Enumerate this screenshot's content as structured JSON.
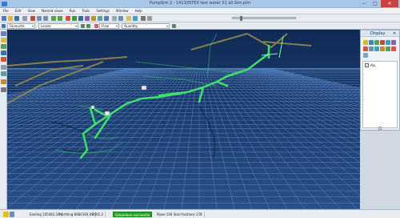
{
  "window": {
    "title": "PumpSim 2 - 14110STEX test water 01 all.Sim.pim",
    "min": "−",
    "max": "□",
    "close": "✕"
  },
  "menu": [
    "File",
    "Edit",
    "View",
    "Named views",
    "Run",
    "Tools",
    "Settings",
    "Window",
    "Help"
  ],
  "toolbar": {
    "combo1": "Favourite",
    "combo2": "Levels",
    "combo3": "Flow",
    "combo4": "Quantity"
  },
  "display_panel": {
    "title": "Display",
    "close": "✕",
    "item_label": "Alu",
    "item_checked": "✓"
  },
  "status": {
    "mode": "",
    "east": "Easting 105481.16",
    "north": "Northing 6660193.09",
    "elev": "2601.2",
    "sim": "Simulation successful",
    "pipes": "Pipes 104  Size fractions 178"
  },
  "colors": {
    "viewport_top": "#0f2a55",
    "viewport_bottom": "#2a4f86",
    "grid": "#6f9fe0",
    "pipe_green": "#3fe06a",
    "pipe_tan": "#9a8a4c",
    "pipe_dark": "#0e1f3a"
  }
}
